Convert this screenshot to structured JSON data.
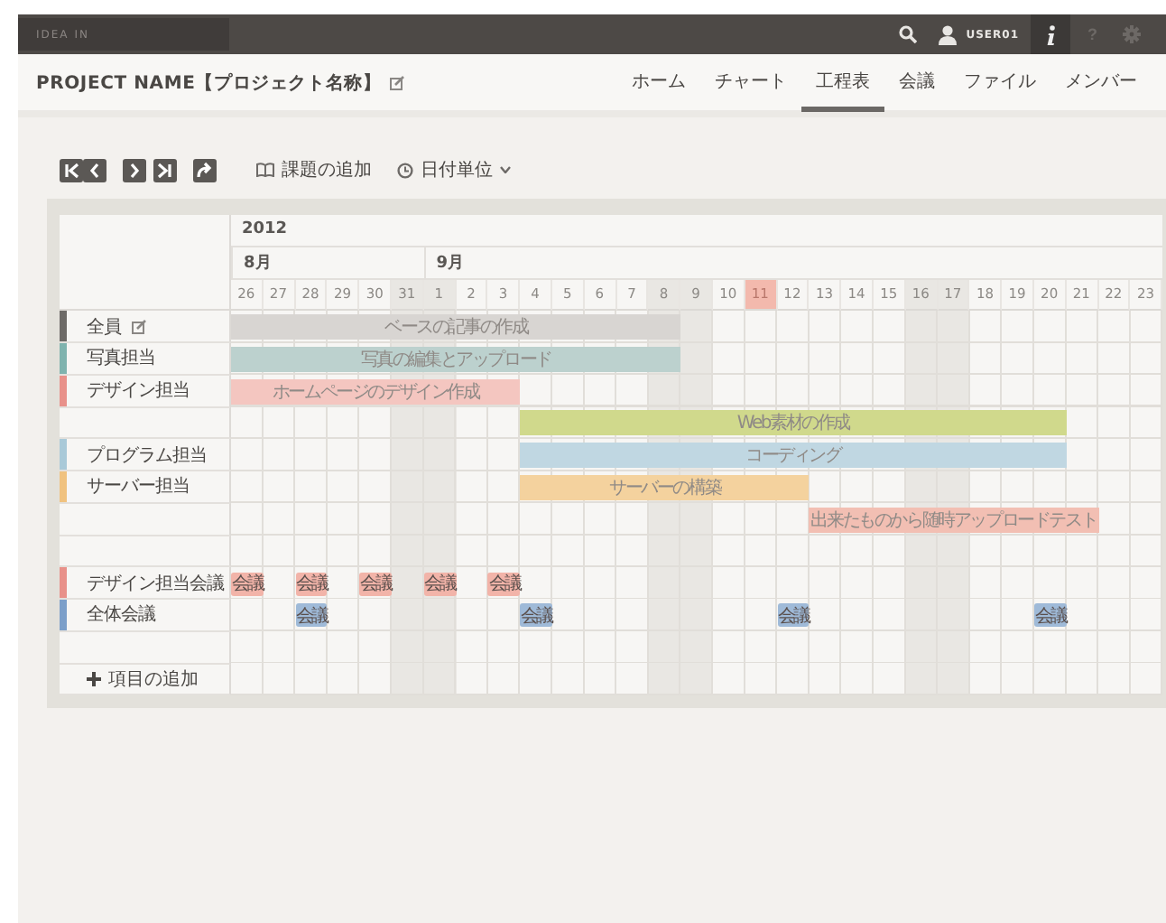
{
  "topbar": {
    "search": {
      "placeholder": "IDEA IN"
    },
    "user": "USER01",
    "info_selected": true,
    "help": "?"
  },
  "header": {
    "title": "PROJECT NAME【プロジェクト名称】",
    "nav": [
      {
        "label": "ホーム",
        "selected": false
      },
      {
        "label": "チャート",
        "selected": false
      },
      {
        "label": "工程表",
        "selected": true
      },
      {
        "label": "会議",
        "selected": false
      },
      {
        "label": "ファイル",
        "selected": false
      },
      {
        "label": "メンバー",
        "selected": false
      }
    ]
  },
  "toolbar": {
    "add_issue": "課題の追加",
    "date_unit": "日付単位"
  },
  "timeline": {
    "year": "2012",
    "months": [
      {
        "label": "8月",
        "days": [
          {
            "label": "26",
            "weekend": false,
            "today": false
          },
          {
            "label": "27",
            "weekend": false,
            "today": false
          },
          {
            "label": "28",
            "weekend": false,
            "today": false
          },
          {
            "label": "29",
            "weekend": false,
            "today": false
          },
          {
            "label": "30",
            "weekend": false,
            "today": false
          },
          {
            "label": "31",
            "weekend": true,
            "today": false
          }
        ]
      },
      {
        "label": "9月",
        "days": [
          {
            "label": "1",
            "weekend": true,
            "today": false
          },
          {
            "label": "2",
            "weekend": false,
            "today": false
          },
          {
            "label": "3",
            "weekend": false,
            "today": false
          },
          {
            "label": "4",
            "weekend": false,
            "today": false
          },
          {
            "label": "5",
            "weekend": false,
            "today": false
          },
          {
            "label": "6",
            "weekend": false,
            "today": false
          },
          {
            "label": "7",
            "weekend": false,
            "today": false
          },
          {
            "label": "8",
            "weekend": true,
            "today": false
          },
          {
            "label": "9",
            "weekend": true,
            "today": false
          },
          {
            "label": "10",
            "weekend": false,
            "today": false
          },
          {
            "label": "11",
            "weekend": false,
            "today": true
          },
          {
            "label": "12",
            "weekend": false,
            "today": false
          },
          {
            "label": "13",
            "weekend": false,
            "today": false
          },
          {
            "label": "14",
            "weekend": false,
            "today": false
          },
          {
            "label": "15",
            "weekend": false,
            "today": false
          },
          {
            "label": "16",
            "weekend": true,
            "today": false
          },
          {
            "label": "17",
            "weekend": true,
            "today": false
          },
          {
            "label": "18",
            "weekend": false,
            "today": false
          },
          {
            "label": "19",
            "weekend": false,
            "today": false
          },
          {
            "label": "20",
            "weekend": false,
            "today": false
          },
          {
            "label": "21",
            "weekend": false,
            "today": false
          },
          {
            "label": "22",
            "weekend": false,
            "today": false
          },
          {
            "label": "23",
            "weekend": false,
            "today": false
          }
        ]
      }
    ]
  },
  "rows": [
    {
      "label": "全員",
      "color": "#6e6b68",
      "editable": true,
      "cells": [
        {
          "kind": "task",
          "label": "ベースの記事の作成",
          "color": "#d8d5d2"
        },
        {
          "kind": "span"
        },
        {
          "kind": "span"
        },
        {
          "kind": "span"
        },
        {
          "kind": "span"
        },
        {
          "kind": "span"
        },
        {
          "kind": "span"
        },
        {
          "kind": "span"
        },
        {
          "kind": "span"
        },
        {
          "kind": "span"
        },
        {
          "kind": "span"
        },
        {
          "kind": "span"
        },
        {
          "kind": "span"
        },
        {
          "kind": "span"
        },
        null,
        null,
        null,
        null,
        null,
        null,
        null,
        null,
        null,
        null,
        null,
        null,
        null,
        null,
        null
      ]
    },
    {
      "label": "写真担当",
      "color": "#7fb3ae",
      "editable": false,
      "cells": [
        {
          "kind": "task",
          "label": "写真の編集とアップロード",
          "color": "#bcd1ce"
        },
        {
          "kind": "span"
        },
        {
          "kind": "span"
        },
        {
          "kind": "span"
        },
        {
          "kind": "span"
        },
        {
          "kind": "span"
        },
        {
          "kind": "span"
        },
        {
          "kind": "span"
        },
        {
          "kind": "span"
        },
        {
          "kind": "span"
        },
        {
          "kind": "span"
        },
        {
          "kind": "span"
        },
        {
          "kind": "span"
        },
        {
          "kind": "span"
        },
        null,
        null,
        null,
        null,
        null,
        null,
        null,
        null,
        null,
        null,
        null,
        null,
        null,
        null,
        null
      ]
    },
    {
      "label": "デザイン担当",
      "color": "#e8918a",
      "editable": false,
      "cells": [
        {
          "kind": "task",
          "label": "ホームページのデザイン作成",
          "color": "#f4c6c0"
        },
        {
          "kind": "span"
        },
        {
          "kind": "span"
        },
        {
          "kind": "span"
        },
        {
          "kind": "span"
        },
        {
          "kind": "span"
        },
        {
          "kind": "span"
        },
        {
          "kind": "span"
        },
        {
          "kind": "span"
        },
        null,
        null,
        null,
        null,
        null,
        null,
        null,
        null,
        null,
        null,
        null,
        null,
        null,
        null,
        null,
        null,
        null,
        null,
        null,
        null
      ]
    },
    {
      "cells": [
        null,
        null,
        null,
        null,
        null,
        null,
        null,
        null,
        null,
        {
          "kind": "task",
          "label": "Web素材の作成",
          "color": "#d0d98c"
        },
        {
          "kind": "span"
        },
        {
          "kind": "span"
        },
        {
          "kind": "span"
        },
        {
          "kind": "span"
        },
        {
          "kind": "span"
        },
        {
          "kind": "span"
        },
        {
          "kind": "span"
        },
        {
          "kind": "span"
        },
        {
          "kind": "span"
        },
        {
          "kind": "span"
        },
        {
          "kind": "span"
        },
        {
          "kind": "span"
        },
        {
          "kind": "span"
        },
        {
          "kind": "span"
        },
        {
          "kind": "span"
        },
        {
          "kind": "span"
        },
        null,
        null,
        null
      ]
    },
    {
      "label": "プログラム担当",
      "color": "#a9c9d8",
      "editable": false,
      "cells": [
        null,
        null,
        null,
        null,
        null,
        null,
        null,
        null,
        null,
        {
          "kind": "task",
          "label": "コーディング",
          "color": "#c0d7e2"
        },
        {
          "kind": "span"
        },
        {
          "kind": "span"
        },
        {
          "kind": "span"
        },
        {
          "kind": "span"
        },
        {
          "kind": "span"
        },
        {
          "kind": "span"
        },
        {
          "kind": "span"
        },
        {
          "kind": "span"
        },
        {
          "kind": "span"
        },
        {
          "kind": "span"
        },
        {
          "kind": "span"
        },
        {
          "kind": "span"
        },
        {
          "kind": "span"
        },
        {
          "kind": "span"
        },
        {
          "kind": "span"
        },
        {
          "kind": "span"
        },
        null,
        null,
        null
      ]
    },
    {
      "label": "サーバー担当",
      "color": "#f0c27f",
      "editable": false,
      "cells": [
        null,
        null,
        null,
        null,
        null,
        null,
        null,
        null,
        null,
        {
          "kind": "task",
          "label": "サーバーの構築",
          "color": "#f4d29e"
        },
        {
          "kind": "span"
        },
        {
          "kind": "span"
        },
        {
          "kind": "span"
        },
        {
          "kind": "span"
        },
        {
          "kind": "span"
        },
        {
          "kind": "span"
        },
        {
          "kind": "span"
        },
        {
          "kind": "span"
        },
        null,
        null,
        null,
        null,
        null,
        null,
        null,
        null,
        null,
        null,
        null
      ]
    },
    {
      "cells": [
        null,
        null,
        null,
        null,
        null,
        null,
        null,
        null,
        null,
        null,
        null,
        null,
        null,
        null,
        null,
        null,
        null,
        null,
        {
          "kind": "task",
          "label": "出来たものから随時アップロードテスト",
          "color": "#f2bfb3"
        },
        {
          "kind": "span"
        },
        {
          "kind": "span"
        },
        {
          "kind": "span"
        },
        {
          "kind": "span"
        },
        {
          "kind": "span"
        },
        {
          "kind": "span"
        },
        {
          "kind": "span"
        },
        {
          "kind": "span"
        },
        null,
        null
      ]
    },
    {
      "cells": [
        null,
        null,
        null,
        null,
        null,
        null,
        null,
        null,
        null,
        null,
        null,
        null,
        null,
        null,
        null,
        null,
        null,
        null,
        null,
        null,
        null,
        null,
        null,
        null,
        null,
        null,
        null,
        null,
        null
      ]
    },
    {
      "label": "デザイン担当会議",
      "color": "#e8918a",
      "editable": false,
      "cells": [
        {
          "kind": "meeting",
          "label": "会議",
          "color": "#f2b4a9"
        },
        null,
        {
          "kind": "meeting",
          "label": "会議",
          "color": "#f2b4a9"
        },
        null,
        {
          "kind": "meeting",
          "label": "会議",
          "color": "#f2b4a9"
        },
        null,
        {
          "kind": "meeting",
          "label": "会議",
          "color": "#f2b4a9"
        },
        null,
        {
          "kind": "meeting",
          "label": "会議",
          "color": "#f2b4a9"
        },
        null,
        null,
        null,
        null,
        null,
        null,
        null,
        null,
        null,
        null,
        null,
        null,
        null,
        null,
        null,
        null,
        null,
        null,
        null,
        null
      ]
    },
    {
      "label": "全体会議",
      "color": "#7c9fc9",
      "editable": false,
      "cells": [
        null,
        null,
        {
          "kind": "meeting",
          "label": "会議",
          "color": "#9fbad8"
        },
        null,
        null,
        null,
        null,
        null,
        null,
        {
          "kind": "meeting",
          "label": "会議",
          "color": "#9fbad8"
        },
        null,
        null,
        null,
        null,
        null,
        null,
        null,
        {
          "kind": "meeting",
          "label": "会議",
          "color": "#9fbad8"
        },
        null,
        null,
        null,
        null,
        null,
        null,
        null,
        {
          "kind": "meeting",
          "label": "会議",
          "color": "#9fbad8"
        },
        null,
        null,
        null
      ]
    },
    {
      "cells": [
        null,
        null,
        null,
        null,
        null,
        null,
        null,
        null,
        null,
        null,
        null,
        null,
        null,
        null,
        null,
        null,
        null,
        null,
        null,
        null,
        null,
        null,
        null,
        null,
        null,
        null,
        null,
        null,
        null
      ]
    }
  ],
  "add_item": "項目の追加"
}
